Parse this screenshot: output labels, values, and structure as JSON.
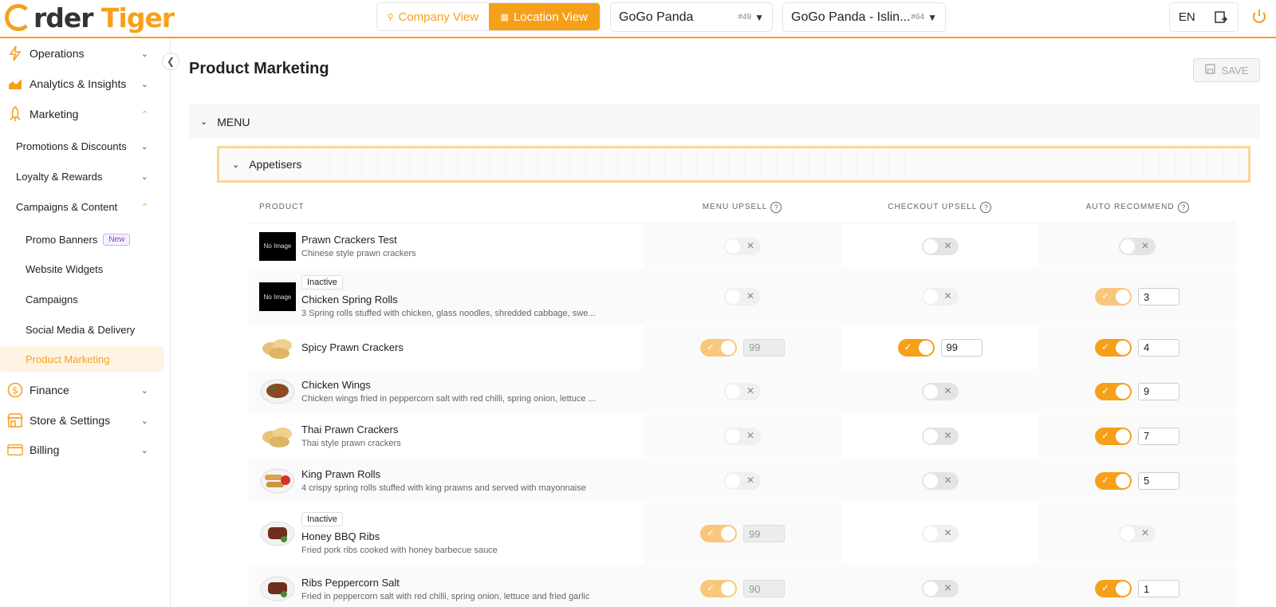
{
  "brand": {
    "logo_text_dark": "rder ",
    "logo_text_orange": "Tiger",
    "accent": "#f6a01a"
  },
  "header": {
    "company_view": "Company View",
    "location_view": "Location View",
    "company_select": {
      "name": "GoGo Panda",
      "id": "#49"
    },
    "location_select": {
      "name": "GoGo Panda - Islin...",
      "id": "#64"
    },
    "language": "EN"
  },
  "sidebar": {
    "operations": "Operations",
    "analytics": "Analytics & Insights",
    "marketing": "Marketing",
    "promotions": "Promotions & Discounts",
    "loyalty": "Loyalty & Rewards",
    "campaigns_content": "Campaigns & Content",
    "promo_banners": "Promo Banners",
    "new_badge": "New",
    "website_widgets": "Website Widgets",
    "campaigns": "Campaigns",
    "social_media": "Social Media & Delivery",
    "product_marketing": "Product Marketing",
    "finance": "Finance",
    "store_settings": "Store & Settings",
    "billing": "Billing"
  },
  "main": {
    "title": "Product Marketing",
    "save_label": "SAVE",
    "menu_label": "MENU",
    "category_label": "Appetisers",
    "columns": {
      "product": "PRODUCT",
      "menu_upsell": "MENU UPSELL",
      "checkout_upsell": "CHECKOUT UPSELL",
      "auto_recommend": "AUTO RECOMMEND"
    },
    "no_image": "No Image",
    "inactive_label": "Inactive"
  },
  "products": [
    {
      "name": "Prawn Crackers Test",
      "desc": "Chinese style prawn crackers",
      "image": "none",
      "inactive": false,
      "menu_upsell": {
        "on": false,
        "value": ""
      },
      "checkout_upsell": {
        "on": false,
        "value": ""
      },
      "auto_recommend": {
        "on": false,
        "value": ""
      }
    },
    {
      "name": "Chicken Spring Rolls",
      "desc": "3 Spring rolls stuffed with chicken, glass noodles, shredded cabbage, swe...",
      "image": "none",
      "inactive": true,
      "menu_upsell": {
        "on": false,
        "value": ""
      },
      "checkout_upsell": {
        "on": false,
        "value": ""
      },
      "auto_recommend": {
        "on": true,
        "value": "3"
      }
    },
    {
      "name": "Spicy Prawn Crackers",
      "desc": "",
      "image": "crackers",
      "inactive": false,
      "menu_upsell": {
        "on": true,
        "value": "99"
      },
      "checkout_upsell": {
        "on": true,
        "value": "99"
      },
      "auto_recommend": {
        "on": true,
        "value": "4"
      }
    },
    {
      "name": "Chicken Wings",
      "desc": "Chicken wings fried in peppercorn salt with red chilli, spring onion, lettuce ...",
      "image": "wings",
      "inactive": false,
      "menu_upsell": {
        "on": false,
        "value": ""
      },
      "checkout_upsell": {
        "on": false,
        "value": ""
      },
      "auto_recommend": {
        "on": true,
        "value": "9"
      }
    },
    {
      "name": "Thai Prawn Crackers",
      "desc": "Thai style prawn crackers",
      "image": "crackers",
      "inactive": false,
      "menu_upsell": {
        "on": false,
        "value": ""
      },
      "checkout_upsell": {
        "on": false,
        "value": ""
      },
      "auto_recommend": {
        "on": true,
        "value": "7"
      }
    },
    {
      "name": "King Prawn Rolls",
      "desc": "4 crispy spring rolls stuffed with king prawns and served with mayonnaise",
      "image": "rolls",
      "inactive": false,
      "menu_upsell": {
        "on": false,
        "value": ""
      },
      "checkout_upsell": {
        "on": false,
        "value": ""
      },
      "auto_recommend": {
        "on": true,
        "value": "5"
      }
    },
    {
      "name": "Honey BBQ Ribs",
      "desc": "Fried pork ribs cooked with honey barbecue sauce",
      "image": "ribs",
      "inactive": true,
      "menu_upsell": {
        "on": true,
        "value": "99"
      },
      "checkout_upsell": {
        "on": false,
        "value": ""
      },
      "auto_recommend": {
        "on": false,
        "value": ""
      }
    },
    {
      "name": "Ribs Peppercorn Salt",
      "desc": "Fried in peppercorn salt with red chilli, spring onion, lettuce and fried garlic",
      "image": "ribs",
      "inactive": false,
      "menu_upsell": {
        "on": true,
        "value": "90"
      },
      "checkout_upsell": {
        "on": false,
        "value": ""
      },
      "auto_recommend": {
        "on": true,
        "value": "1"
      }
    }
  ]
}
